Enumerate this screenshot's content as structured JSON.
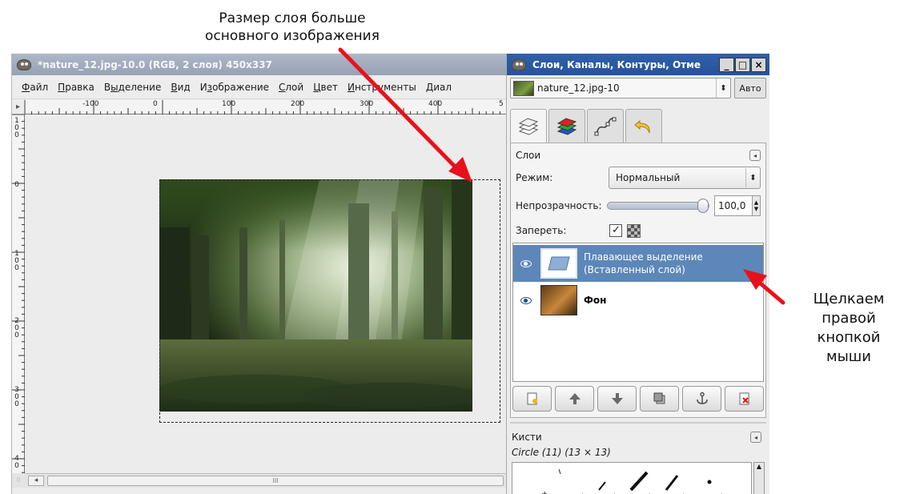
{
  "annotations": {
    "top_line1": "Размер слоя больше",
    "top_line2": "основного изображения",
    "right_line1": "Щелкаем",
    "right_line2": "правой кнопкой",
    "right_line3": "мыши"
  },
  "image_window": {
    "title": "*nature_12.jpg-10.0 (RGB, 2 слоя) 450x337",
    "menu": [
      {
        "ul": "Ф",
        "rest": "айл"
      },
      {
        "ul": "П",
        "rest": "равка"
      },
      {
        "pre": "В",
        "ul": "ы",
        "rest": "деление"
      },
      {
        "ul": "В",
        "rest": "ид"
      },
      {
        "pre": "И",
        "ul": "з",
        "rest": "ображение"
      },
      {
        "ul": "С",
        "rest": "лой"
      },
      {
        "ul": "Ц",
        "rest": "вет"
      },
      {
        "ul": "И",
        "rest": "нструменты"
      },
      {
        "ul": "Д",
        "rest": "иал"
      }
    ],
    "ruler_top_labels": [
      "-100",
      "0",
      "100",
      "200",
      "300",
      "400",
      "5"
    ],
    "ruler_left_labels": [
      [
        "1",
        "0",
        "0"
      ],
      [
        "0"
      ],
      [
        "1",
        "0",
        "0"
      ],
      [
        "2",
        "0",
        "0"
      ],
      [
        "3",
        "0",
        "0"
      ],
      [
        "4",
        "0"
      ]
    ],
    "scroll_marker": "III"
  },
  "dock": {
    "title": "Слои, Каналы, Контуры, Отме",
    "wm_buttons": [
      "_",
      "□",
      "×"
    ],
    "image_combo": "nature_12.jpg-10",
    "auto_button": "Авто",
    "tabs": [
      "layers-tab",
      "channels-tab",
      "paths-tab",
      "undo-tab"
    ],
    "layers": {
      "heading": "Слои",
      "mode_label": "Режим:",
      "mode_value": "Нормальный",
      "opacity_label": "Непрозрачность:",
      "opacity_value": "100,0",
      "opacity_fraction": 1.0,
      "lock_label": "Запереть:",
      "lock_checked": true,
      "items": [
        {
          "name_line1": "Плавающее выделение",
          "name_line2": "(Вставленный слой)",
          "selected": true
        },
        {
          "name_line1": "Фон",
          "name_line2": "",
          "selected": false
        }
      ],
      "buttons": [
        "new-layer",
        "raise-layer",
        "lower-layer",
        "duplicate-layer",
        "anchor-layer",
        "delete-layer"
      ]
    },
    "brushes": {
      "heading": "Кисти",
      "current": "Circle (11) (13 × 13)"
    }
  },
  "colors": {
    "dock_title": "#2a5aa2",
    "selection": "#5d87b8",
    "arrow": "#e8111b"
  }
}
